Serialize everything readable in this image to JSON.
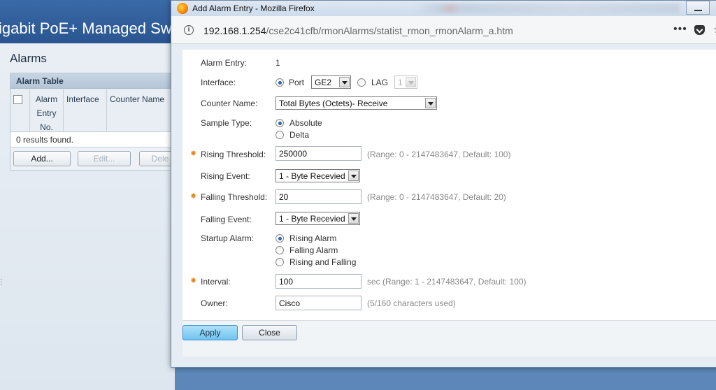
{
  "background_app": {
    "title": "igabit PoE+ Managed Sw",
    "page_title": "Alarms",
    "table_caption": "Alarm Table",
    "columns": [
      "Alarm Entry No.",
      "Interface",
      "Counter Name"
    ],
    "column_entry_lines": [
      "Alarm",
      "Entry",
      "No."
    ],
    "results": "0 results found.",
    "buttons": {
      "add": "Add...",
      "edit": "Edit...",
      "delete": "Dele"
    }
  },
  "window": {
    "title": "Add Alarm Entry - Mozilla Firefox",
    "url_host": "192.168.1.254",
    "url_path": "/cse2c41cfb/rmonAlarms/statist_rmon_rmonAlarm_a.htm",
    "more_glyph": "•••",
    "star_glyph": "☆"
  },
  "form": {
    "alarm_entry": {
      "label": "Alarm Entry:",
      "value": "1"
    },
    "interface": {
      "label": "Interface:",
      "port_label": "Port",
      "port_value": "GE2",
      "lag_label": "LAG",
      "lag_value": "1",
      "selected": "Port"
    },
    "counter_name": {
      "label": "Counter Name:",
      "value": "Total Bytes (Octets)- Receive"
    },
    "sample_type": {
      "label": "Sample Type:",
      "options": [
        "Absolute",
        "Delta"
      ],
      "selected": "Absolute"
    },
    "rising_threshold": {
      "label": "Rising Threshold:",
      "value": "250000",
      "hint": "(Range: 0 - 2147483647, Default: 100)"
    },
    "rising_event": {
      "label": "Rising Event:",
      "value": "1 - Byte Recevied"
    },
    "falling_threshold": {
      "label": "Falling Threshold:",
      "value": "20",
      "hint": "(Range: 0 - 2147483647, Default: 20)"
    },
    "falling_event": {
      "label": "Falling Event:",
      "value": "1 - Byte Recevied"
    },
    "startup_alarm": {
      "label": "Startup Alarm:",
      "options": [
        "Rising Alarm",
        "Falling Alarm",
        "Rising and Falling"
      ],
      "selected": "Rising Alarm"
    },
    "interval": {
      "label": "Interval:",
      "value": "100",
      "hint": "sec (Range: 1 - 2147483647, Default: 100)"
    },
    "owner": {
      "label": "Owner:",
      "value": "Cisco",
      "hint": "(5/160 characters used)"
    }
  },
  "buttons": {
    "apply": "Apply",
    "close": "Close"
  },
  "colors": {
    "required_star": "#e58a1f",
    "apply_button": "#6fc3ef",
    "banner": "#2a5590"
  }
}
